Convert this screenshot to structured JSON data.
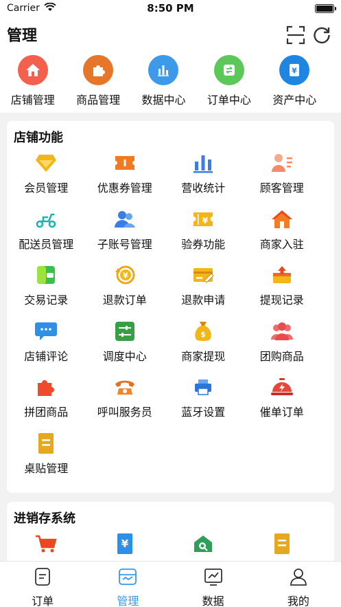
{
  "status_bar": {
    "carrier": "Carrier",
    "time": "8:50 PM"
  },
  "header": {
    "title": "管理",
    "actions": [
      {
        "icon": "scan-icon"
      },
      {
        "icon": "refresh-icon"
      }
    ],
    "quick_links": [
      {
        "label": "店铺管理",
        "icon": "house-icon",
        "color": "#f4604d"
      },
      {
        "label": "商品管理",
        "icon": "puzzle-icon",
        "color": "#ef8a2a"
      },
      {
        "label": "数据中心",
        "icon": "bar-chart-icon",
        "color": "#3c9ae8"
      },
      {
        "label": "订单中心",
        "icon": "exchange-icon",
        "color": "#5cc859"
      },
      {
        "label": "资产中心",
        "icon": "yen-document-icon",
        "color": "#1e86e0"
      }
    ]
  },
  "store_functions": {
    "title": "店铺功能",
    "items": [
      {
        "label": "会员管理",
        "icon": "diamond-icon"
      },
      {
        "label": "优惠券管理",
        "icon": "coupon-icon"
      },
      {
        "label": "营收统计",
        "icon": "bar-chart-icon"
      },
      {
        "label": "顾客管理",
        "icon": "customer-list-icon"
      },
      {
        "label": "配送员管理",
        "icon": "scooter-icon"
      },
      {
        "label": "子账号管理",
        "icon": "users-icon"
      },
      {
        "label": "验券功能",
        "icon": "ticket-yen-icon"
      },
      {
        "label": "商家入驻",
        "icon": "house-icon"
      },
      {
        "label": "交易记录",
        "icon": "wallet-icon"
      },
      {
        "label": "退款订单",
        "icon": "yen-refund-icon"
      },
      {
        "label": "退款申请",
        "icon": "card-edit-icon"
      },
      {
        "label": "提现记录",
        "icon": "withdraw-icon"
      },
      {
        "label": "店铺评论",
        "icon": "chat-bubble-icon"
      },
      {
        "label": "调度中心",
        "icon": "sliders-icon"
      },
      {
        "label": "商家提现",
        "icon": "money-bag-icon"
      },
      {
        "label": "团购商品",
        "icon": "group-icon"
      },
      {
        "label": "拼团商品",
        "icon": "puzzle-icon"
      },
      {
        "label": "呼叫服务员",
        "icon": "phone-icon"
      },
      {
        "label": "蓝牙设置",
        "icon": "printer-icon"
      },
      {
        "label": "催单订单",
        "icon": "bell-dish-icon"
      },
      {
        "label": "桌贴管理",
        "icon": "note-icon"
      }
    ]
  },
  "inventory_system": {
    "title": "进销存系统",
    "items": [
      {
        "icon": "cart-icon"
      },
      {
        "icon": "yen-receipt-icon"
      },
      {
        "icon": "store-search-icon"
      },
      {
        "icon": "note-icon"
      }
    ]
  },
  "tab_bar": {
    "active": 1,
    "tabs": [
      {
        "label": "订单",
        "icon": "order-icon"
      },
      {
        "label": "管理",
        "icon": "manage-icon"
      },
      {
        "label": "数据",
        "icon": "data-icon"
      },
      {
        "label": "我的",
        "icon": "profile-icon"
      }
    ]
  }
}
